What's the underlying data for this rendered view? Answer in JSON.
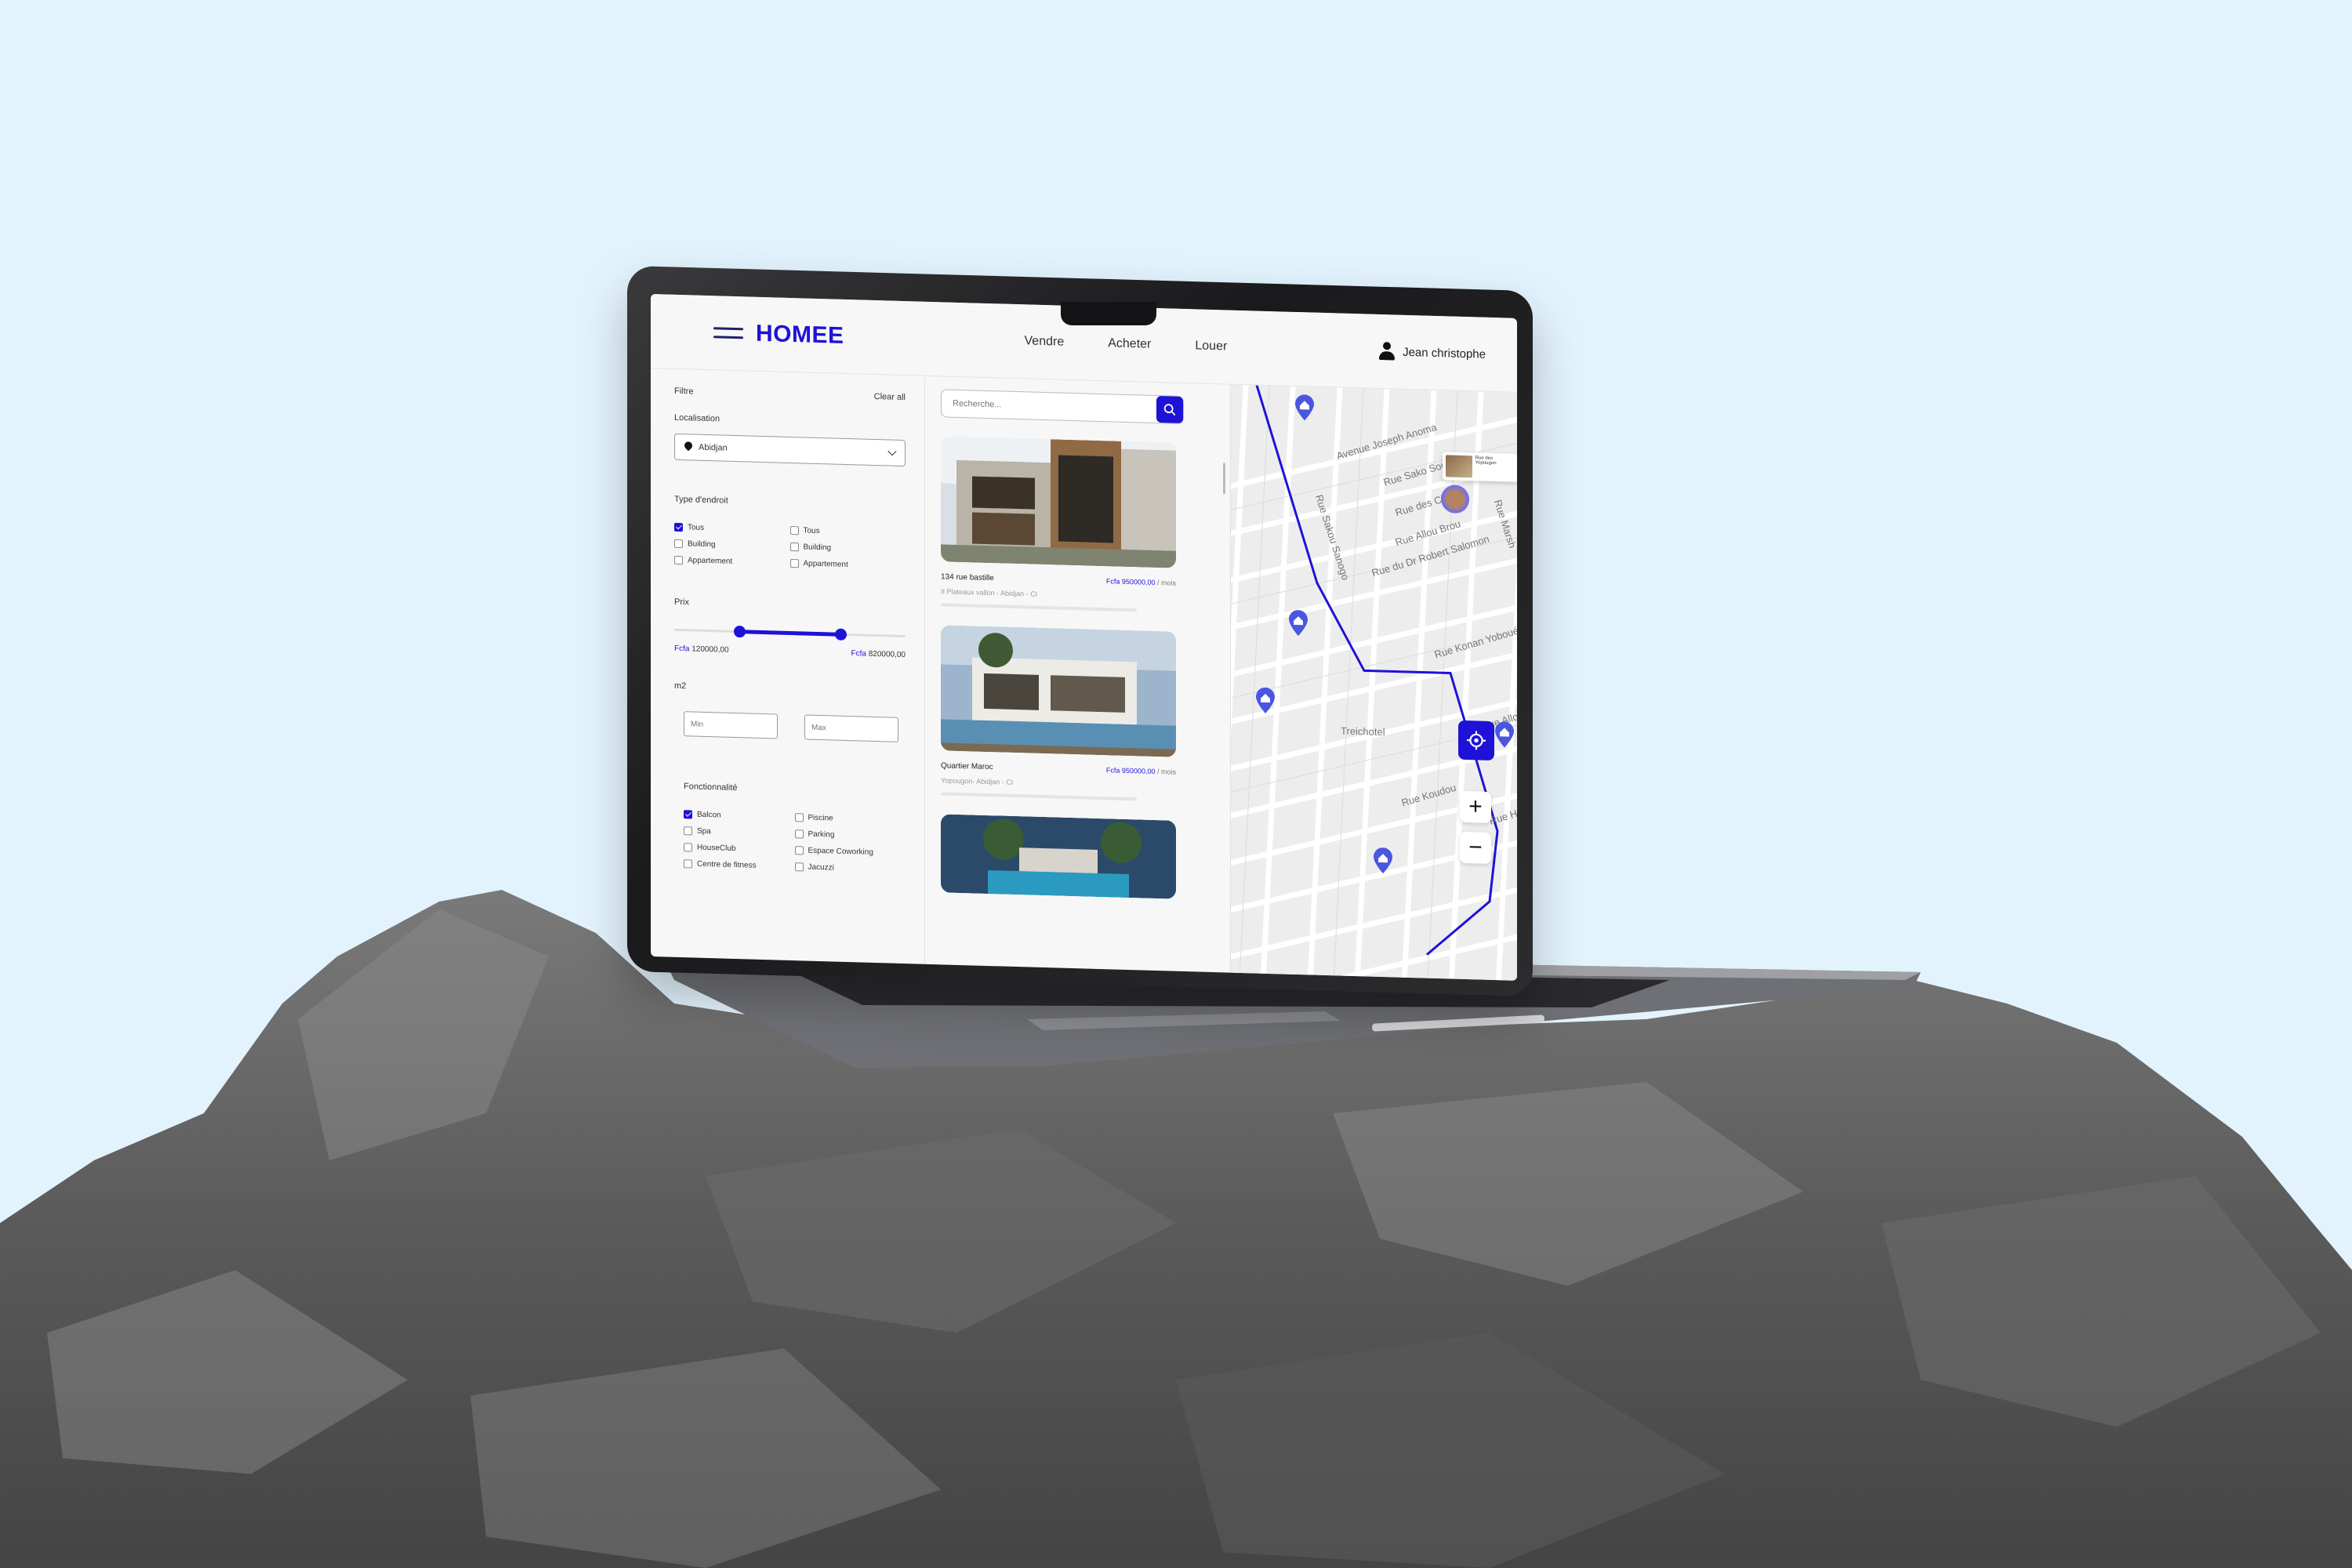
{
  "app": {
    "logo": "HOMEE",
    "nav": [
      "Vendre",
      "Acheter",
      "Louer"
    ],
    "user_name": "Jean christophe"
  },
  "filters": {
    "title": "Filtre",
    "clear_all": "Clear all",
    "location_label": "Localisation",
    "location_value": "Abidjan",
    "type_label": "Type d'endroit",
    "type_left": [
      {
        "label": "Tous",
        "checked": true
      },
      {
        "label": "Building",
        "checked": false
      },
      {
        "label": "Appartement",
        "checked": false
      }
    ],
    "type_right": [
      {
        "label": "Tous",
        "checked": false
      },
      {
        "label": "Building",
        "checked": false
      },
      {
        "label": "Appartement",
        "checked": false
      }
    ],
    "price_label": "Prix",
    "price_min_currency": "Fcfa",
    "price_min": "120000,00",
    "price_max_currency": "Fcfa",
    "price_max": "820000,00",
    "price_range_fraction": [
      0.28,
      0.72
    ],
    "area_label": "m2",
    "area_min_placeholder": "Min",
    "area_max_placeholder": "Max",
    "features_label": "Fonctionnalité",
    "features_left": [
      {
        "label": "Balcon",
        "checked": true
      },
      {
        "label": "Spa",
        "checked": false
      },
      {
        "label": "HouseClub",
        "checked": false
      },
      {
        "label": "Centre de fitness",
        "checked": false
      }
    ],
    "features_right": [
      {
        "label": "Piscine",
        "checked": false
      },
      {
        "label": "Parking",
        "checked": false
      },
      {
        "label": "Espace Coworking",
        "checked": false
      },
      {
        "label": "Jacuzzi",
        "checked": false
      }
    ]
  },
  "listing": {
    "search_placeholder": "Recherche...",
    "cards": [
      {
        "title": "134 rue bastille",
        "currency": "Fcfa",
        "price": "950000,00",
        "period": "/ mois",
        "location": "II Plateaux vallon - Abidjan - CI"
      },
      {
        "title": "Quartier Maroc",
        "currency": "Fcfa",
        "price": "950000,00",
        "period": "/ mois",
        "location": "Yopougon- Abidjan - CI"
      }
    ]
  },
  "map": {
    "streets": [
      "Avenue Joseph Anoma",
      "Rue Sako Soumata",
      "Rue des Chefs",
      "Rue Allou Brou",
      "Rue du Dr Robert Salomon",
      "Rue Sakou Sanogo",
      "Rue Konan Yoboué",
      "Rue Koudou",
      "Treichotel",
      "Rue Allo",
      "Rue Marsh",
      "Rue Hadi"
    ],
    "popup_text": "Rue des Yopougon",
    "accent": "#1e12d8",
    "zoom_in": "+",
    "zoom_out": "−"
  }
}
